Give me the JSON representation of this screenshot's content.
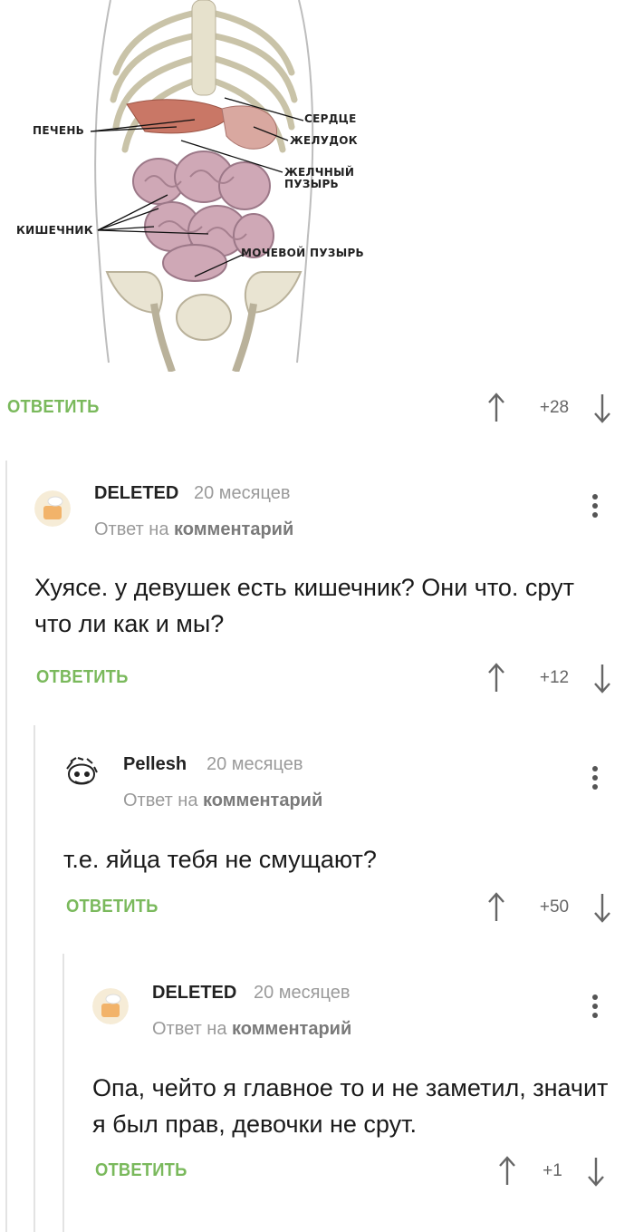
{
  "image": {
    "labels": {
      "heart": "СЕРДЦЕ",
      "liver": "ПЕЧЕНЬ",
      "stomach": "ЖЕЛУДОК",
      "gallbladder_1": "ЖЕЛЧНЫЙ",
      "gallbladder_2": "ПУЗЫРЬ",
      "intestine": "КИШЕЧНИК",
      "bladder": "МОЧЕВОЙ ПУЗЫРЬ"
    }
  },
  "top_actions": {
    "reply": "ОТВЕТИТЬ",
    "score": "+28"
  },
  "comments": [
    {
      "author": "DELETED",
      "time": "20 месяцев",
      "reply_prefix": "Ответ на",
      "reply_target": "комментарий",
      "text": "Хуясе. у девушек есть кишечник? Они что. срут что ли как и мы?",
      "reply": "ОТВЕТИТЬ",
      "score": "+12"
    },
    {
      "author": "Pellesh",
      "time": "20 месяцев",
      "reply_prefix": "Ответ на",
      "reply_target": "комментарий",
      "text": "т.е. яйца тебя не смущают?",
      "reply": "ОТВЕТИТЬ",
      "score": "+50"
    },
    {
      "author": "DELETED",
      "time": "20 месяцев",
      "reply_prefix": "Ответ на",
      "reply_target": "комментарий",
      "text": "Опа, чейто я главное то и не заметил, значит я был прав, девочки не срут.",
      "reply": "ОТВЕТИТЬ",
      "score": "+1"
    }
  ],
  "colors": {
    "accent": "#7ab95c",
    "muted": "#9a9a9a",
    "line": "#e3e3e3"
  }
}
